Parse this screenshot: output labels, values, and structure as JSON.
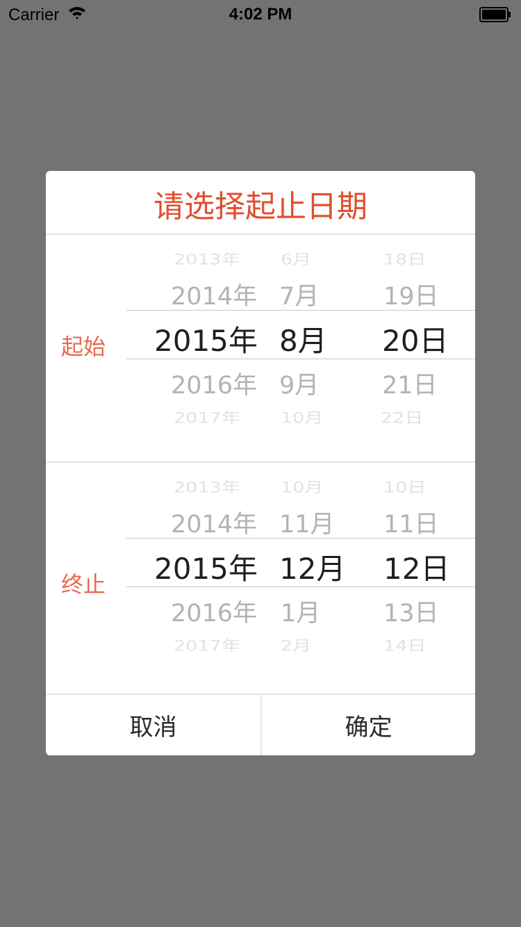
{
  "status_bar": {
    "carrier": "Carrier",
    "time": "4:02 PM"
  },
  "dialog": {
    "title": "请选择起止日期",
    "start": {
      "label": "起始",
      "years": [
        "2013年",
        "2014年",
        "2015年",
        "2016年",
        "2017年"
      ],
      "months": [
        "6月",
        "7月",
        "8月",
        "9月",
        "10月"
      ],
      "days": [
        "18日",
        "19日",
        "20日",
        "21日",
        "22日"
      ],
      "selected": {
        "year": "2015年",
        "month": "8月",
        "day": "20日"
      }
    },
    "end": {
      "label": "终止",
      "years": [
        "2013年",
        "2014年",
        "2015年",
        "2016年",
        "2017年"
      ],
      "months": [
        "10月",
        "11月",
        "12月",
        "1月",
        "2月"
      ],
      "days": [
        "10日",
        "11日",
        "12日",
        "13日",
        "14日"
      ],
      "selected": {
        "year": "2015年",
        "month": "12月",
        "day": "12日"
      }
    },
    "cancel_label": "取消",
    "confirm_label": "确定"
  },
  "colors": {
    "overlay": "#737373",
    "title": "#e04f2f",
    "section_label": "#e86a4d",
    "selected_text": "#1f1f1f"
  }
}
